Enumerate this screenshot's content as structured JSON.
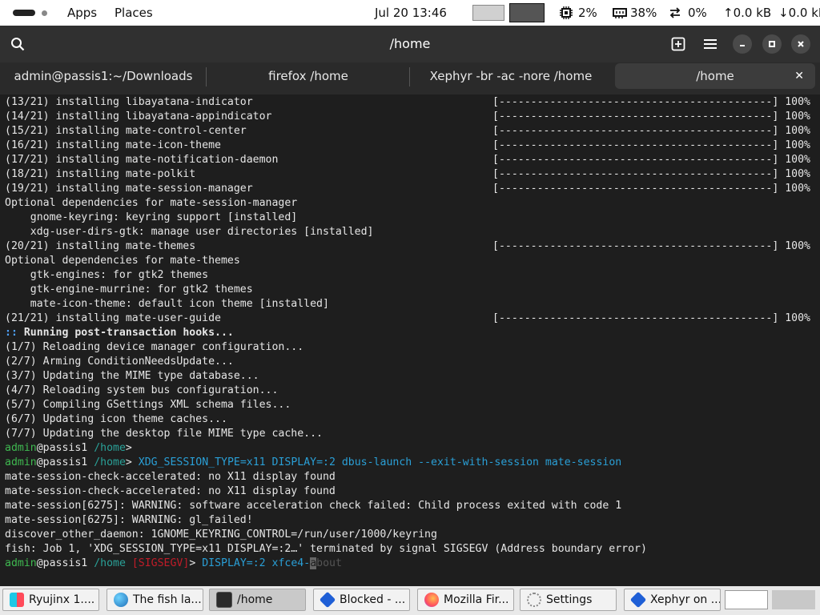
{
  "top_panel": {
    "apps_label": "Apps",
    "places_label": "Places",
    "clock": "Jul 20  13:46",
    "cpu": "2%",
    "memory": "38%",
    "swap": "0%",
    "upload": "0.0 kB",
    "download": "0.0 kB"
  },
  "window": {
    "title": "/home"
  },
  "tabs": [
    {
      "label": "admin@passis1:~/Downloads"
    },
    {
      "label": "firefox /home"
    },
    {
      "label": "Xephyr -br -ac -nore /home"
    },
    {
      "label": "/home",
      "active": true
    }
  ],
  "terminal": {
    "bar_text": "[-------------------------------------------] 100%",
    "lines": [
      "(13/21) installing libayatana-indicator",
      "(14/21) installing libayatana-appindicator",
      "(15/21) installing mate-control-center",
      "(16/21) installing mate-icon-theme",
      "(17/21) installing mate-notification-daemon",
      "(18/21) installing mate-polkit",
      "(19/21) installing mate-session-manager",
      "Optional dependencies for mate-session-manager",
      "    gnome-keyring: keyring support [installed]",
      "    xdg-user-dirs-gtk: manage user directories [installed]",
      "(20/21) installing mate-themes",
      "Optional dependencies for mate-themes",
      "    gtk-engines: for gtk2 themes",
      "    gtk-engine-murrine: for gtk2 themes",
      "    mate-icon-theme: default icon theme [installed]",
      "(21/21) installing mate-user-guide",
      "Running post-transaction hooks...",
      "(1/7) Reloading device manager configuration...",
      "(2/7) Arming ConditionNeedsUpdate...",
      "(3/7) Updating the MIME type database...",
      "(4/7) Reloading system bus configuration...",
      "(5/7) Compiling GSettings XML schema files...",
      "(6/7) Updating icon theme caches...",
      "(7/7) Updating the desktop file MIME type cache...",
      "mate-session-check-accelerated: no X11 display found",
      "mate-session-check-accelerated: no X11 display found",
      "mate-session[6275]: WARNING: software acceleration check failed: Child process exited with code 1",
      "mate-session[6275]: WARNING: gl_failed!",
      "discover_other_daemon: 1GNOME_KEYRING_CONTROL=/run/user/1000/keyring",
      "fish: Job 1, 'XDG_SESSION_TYPE=x11 DISPLAY=:2…' terminated by signal SIGSEGV (Address boundary error)"
    ],
    "hook_prefix": "::",
    "prompt_user": "admin",
    "prompt_host": "@passis1",
    "prompt_path": "/home",
    "prompt_sigil": ">",
    "cmd1": "XDG_SESSION_TYPE=x11 DISPLAY=:2 dbus-launch --exit-with-session mate-session",
    "sig_tag": "[SIGSEGV]",
    "cmd2_typed": "DISPLAY=:2 xfce4-",
    "cmd2_cursor": "a",
    "cmd2_suggest": "bout"
  },
  "taskbar": [
    {
      "label": "Ryujinx 1....",
      "icon": "ryujinx-icon"
    },
    {
      "label": "The fish la...",
      "icon": "globe-icon"
    },
    {
      "label": "/home",
      "icon": "terminal-icon",
      "active": true
    },
    {
      "label": "Blocked - ...",
      "icon": "diamond-icon"
    },
    {
      "label": "Mozilla Fir...",
      "icon": "firefox-icon"
    },
    {
      "label": "Settings",
      "icon": "spinner-icon"
    },
    {
      "label": "Xephyr on ...",
      "icon": "diamond-icon"
    }
  ]
}
